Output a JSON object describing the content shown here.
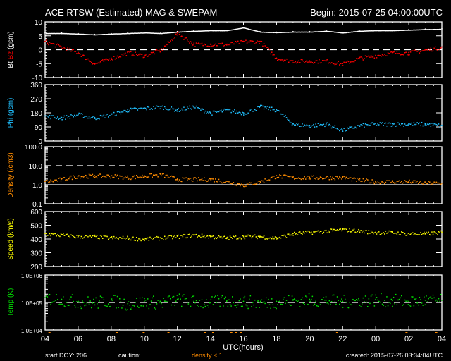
{
  "header": {
    "title": "ACE RTSW (Estimated) MAG & SWEPAM",
    "begin": "Begin: 2015-07-25 04:00:00UTC"
  },
  "footer": {
    "start_doy": "start DOY: 206",
    "caution": "caution:",
    "caution_note": "density < 1",
    "created": "created: 2015-07-26 03:34:04UTC"
  },
  "colors": {
    "bt": "#ffffff",
    "bz": "#ff0000",
    "phi": "#20c0ff",
    "density": "#ff8c00",
    "speed": "#ffff00",
    "temp": "#00e000"
  },
  "chart_data": {
    "type": "scatter",
    "xlabel": "UTC(hours)",
    "x_ticks": [
      "04",
      "06",
      "08",
      "10",
      "12",
      "14",
      "16",
      "18",
      "20",
      "22",
      "00",
      "02",
      "04"
    ],
    "x_hours": [
      0,
      1,
      2,
      3,
      4,
      5,
      6,
      7,
      8,
      9,
      10,
      11,
      12,
      13,
      14,
      15,
      16,
      17,
      18,
      19,
      20,
      21,
      22,
      23,
      24
    ],
    "panels": [
      {
        "ylabel_parts": [
          "Bt",
          " ",
          "Bz",
          " (gsm)"
        ],
        "ylim": [
          -10,
          10
        ],
        "scale": "linear",
        "ticks": [
          {
            "v": 10,
            "label": "10"
          },
          {
            "v": 5,
            "label": "5"
          },
          {
            "v": 0,
            "label": "0"
          },
          {
            "v": -5,
            "label": "-5"
          },
          {
            "v": -10,
            "label": "-10"
          }
        ],
        "reflines": [
          {
            "v": 0,
            "dash": true
          }
        ],
        "series": [
          {
            "name": "Bt",
            "color": "#ffffff",
            "values": [
              6,
              6,
              5.8,
              5.5,
              5.8,
              6,
              6.2,
              6,
              6.5,
              6.8,
              7,
              7,
              8,
              6.5,
              6.3,
              6.5,
              6.5,
              6.8,
              6.2,
              6.8,
              7,
              7,
              7.2,
              7.4,
              7.5
            ]
          },
          {
            "name": "Bz",
            "color": "#ff0000",
            "values": [
              3,
              1,
              -1,
              -5,
              -3,
              -1,
              -2,
              0,
              6,
              2,
              2,
              2,
              3,
              3,
              -3,
              -4,
              -4,
              -4,
              -5,
              -3,
              -2,
              -1,
              -1,
              0,
              1
            ]
          }
        ]
      },
      {
        "ylabel_parts": [
          "Phi",
          " (gsm)"
        ],
        "ylim": [
          0,
          360
        ],
        "scale": "linear",
        "ticks": [
          {
            "v": 360,
            "label": "360"
          },
          {
            "v": 270,
            "label": "270"
          },
          {
            "v": 180,
            "label": "180"
          },
          {
            "v": 90,
            "label": "90"
          },
          {
            "v": 0,
            "label": "0"
          }
        ],
        "reflines": [],
        "series": [
          {
            "name": "Phi",
            "color": "#20c0ff",
            "values": [
              160,
              150,
              170,
              150,
              170,
              200,
              210,
              220,
              200,
              220,
              180,
              200,
              180,
              220,
              200,
              110,
              100,
              110,
              70,
              100,
              110,
              110,
              110,
              110,
              100
            ]
          }
        ]
      },
      {
        "ylabel_parts": [
          "Density",
          " (/cm3)"
        ],
        "ylim": [
          0.1,
          100
        ],
        "scale": "log",
        "ticks": [
          {
            "v": 100,
            "label": "100.0"
          },
          {
            "v": 10,
            "label": "10.0"
          },
          {
            "v": 1,
            "label": "1.0"
          },
          {
            "v": 0.1,
            "label": "0.1"
          }
        ],
        "reflines": [
          {
            "v": 10,
            "dash": true
          },
          {
            "v": 1,
            "dash": false
          }
        ],
        "series": [
          {
            "name": "Density",
            "color": "#ff8c00",
            "values": [
              1.5,
              2,
              3,
              3,
              3,
              2.5,
              3,
              3.5,
              2,
              2,
              2,
              1.5,
              1,
              1.5,
              3,
              2.5,
              2.5,
              2.5,
              2.5,
              1.8,
              1.5,
              1.5,
              1.5,
              1.3,
              1.2
            ]
          }
        ]
      },
      {
        "ylabel_parts": [
          "Speed",
          " (km/s)"
        ],
        "ylim": [
          200,
          600
        ],
        "scale": "linear",
        "ticks": [
          {
            "v": 600,
            "label": "600"
          },
          {
            "v": 500,
            "label": "500"
          },
          {
            "v": 400,
            "label": "400"
          },
          {
            "v": 300,
            "label": "300"
          },
          {
            "v": 200,
            "label": "200"
          }
        ],
        "reflines": [],
        "series": [
          {
            "name": "Speed",
            "color": "#ffff00",
            "values": [
              440,
              430,
              420,
              420,
              410,
              410,
              400,
              410,
              420,
              430,
              420,
              410,
              420,
              420,
              410,
              440,
              450,
              460,
              470,
              460,
              450,
              450,
              440,
              440,
              450
            ]
          }
        ]
      },
      {
        "ylabel_parts": [
          "Temp",
          " (K)"
        ],
        "ylim": [
          10000,
          1000000
        ],
        "scale": "log",
        "ticks": [
          {
            "v": 1000000,
            "label": "1.0E+06"
          },
          {
            "v": 100000,
            "label": "1.0E+05"
          },
          {
            "v": 10000,
            "label": "1.0E+04"
          }
        ],
        "reflines": [
          {
            "v": 100000,
            "dash": true
          }
        ],
        "series": [
          {
            "name": "Temp",
            "color": "#00e000",
            "values": [
              150000,
              130000,
              110000,
              100000,
              120000,
              90000,
              110000,
              100000,
              130000,
              110000,
              100000,
              120000,
              110000,
              100000,
              110000,
              120000,
              130000,
              120000,
              110000,
              120000,
              130000,
              120000,
              110000,
              120000,
              120000
            ]
          }
        ]
      }
    ]
  }
}
